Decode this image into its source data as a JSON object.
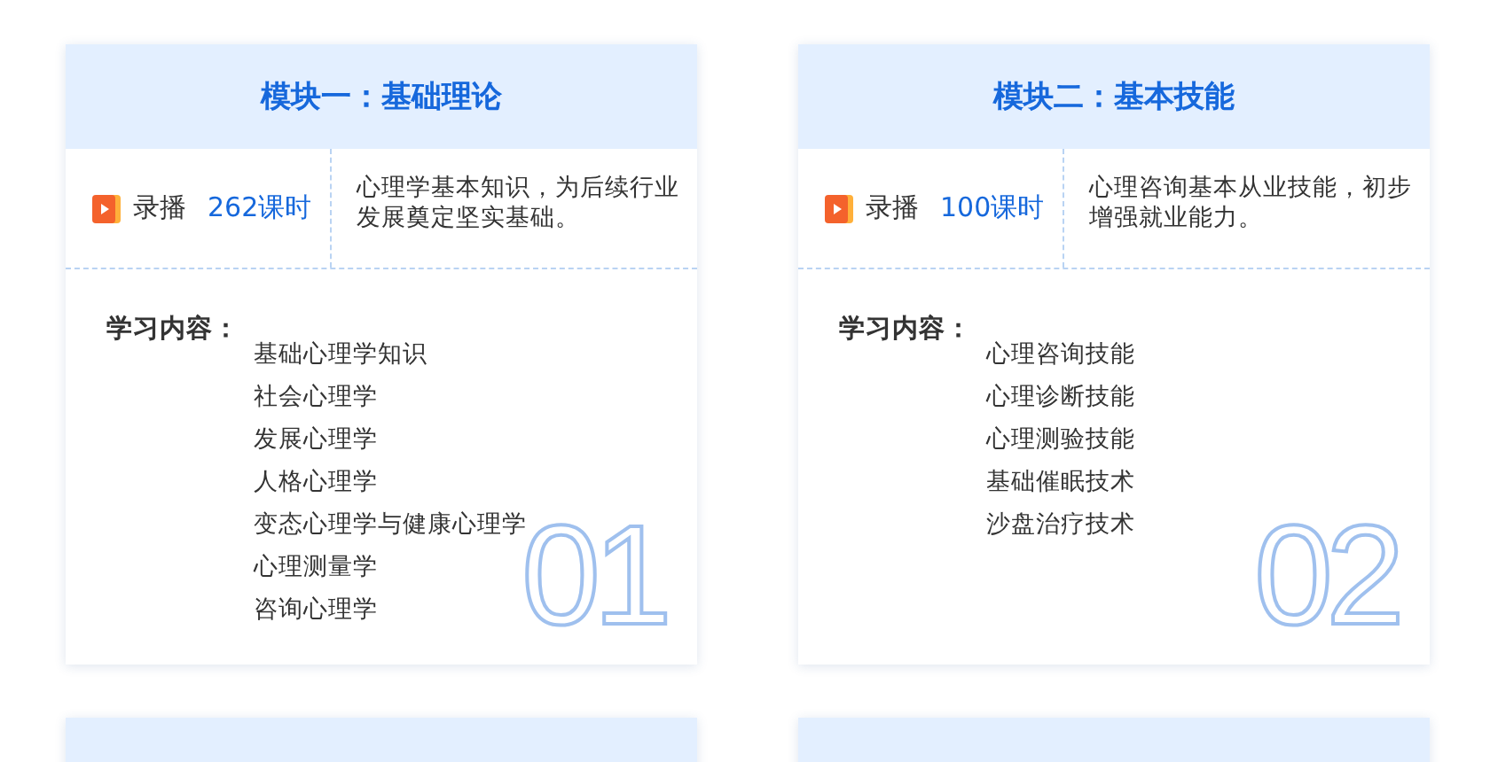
{
  "modules": [
    {
      "title": "模块一：基础理论",
      "mode": "录播",
      "hours": "262课时",
      "summary": "心理学基本知识，为后续行业发展奠定坚实基础。",
      "content_label": "学习内容：",
      "topics": [
        "基础心理学知识",
        "社会心理学",
        "发展心理学",
        "人格心理学",
        "变态心理学与健康心理学",
        "心理测量学",
        "咨询心理学"
      ],
      "number": "01"
    },
    {
      "title": "模块二：基本技能",
      "mode": "录播",
      "hours": "100课时",
      "summary": "心理咨询基本从业技能，初步增强就业能力。",
      "content_label": "学习内容：",
      "topics": [
        "心理咨询技能",
        "心理诊断技能",
        "心理测验技能",
        "基础催眠技术",
        "沙盘治疗技术"
      ],
      "number": "02"
    }
  ]
}
